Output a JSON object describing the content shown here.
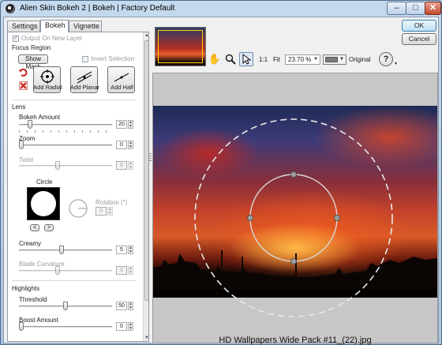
{
  "window": {
    "title": "Alien Skin Bokeh 2 | Bokeh | Factory Default",
    "min_glyph": "–",
    "max_glyph": "□",
    "close_glyph": "✕"
  },
  "tabs": [
    {
      "label": "Settings",
      "active": false
    },
    {
      "label": "Bokeh",
      "active": true
    },
    {
      "label": "Vignette",
      "active": false
    }
  ],
  "panel": {
    "output_new_layer": {
      "label": "Output On New Layer",
      "checked": true,
      "enabled": false
    },
    "focus_region": {
      "title": "Focus Region",
      "show_mask": "Show Mask",
      "invert_selection": {
        "label": "Invert Selection",
        "checked": false
      },
      "add_radial": "Add Radial",
      "add_planar": "Add Planar",
      "add_half": "Add Half"
    },
    "lens": {
      "title": "Lens",
      "bokeh_amount": {
        "label": "Bokeh Amount",
        "value": "20",
        "fraction": 0.2
      },
      "zoom": {
        "label": "Zoom",
        "value": "0",
        "fraction": 0.0
      },
      "twist": {
        "label": "Twist",
        "value": "0",
        "fraction": 0.4
      },
      "circle": {
        "label": "Circle",
        "prev": "<",
        "next": ">"
      },
      "rotation": {
        "label": "Rotation (°)",
        "value": "0"
      },
      "creamy": {
        "label": "Creamy",
        "value": "5",
        "fraction": 0.45
      },
      "blade_curvature": {
        "label": "Blade Curvature",
        "value": "0",
        "fraction": 0.4
      }
    },
    "highlights": {
      "title": "Highlights",
      "threshold": {
        "label": "Threshold",
        "value": "50",
        "fraction": 0.5
      },
      "boost_amount": {
        "label": "Boost Amount",
        "value": "0",
        "fraction": 0.0
      }
    }
  },
  "toolbar": {
    "hand_icon": "hand-tool-icon",
    "zoom_icon": "magnifier-icon",
    "select_icon": "arrow-pointer-icon",
    "one_to_one": "1:1",
    "fit": "Fit",
    "zoom_level": "23.70 %",
    "original": "Original",
    "help_glyph": "?"
  },
  "buttons": {
    "ok": "OK",
    "cancel": "Cancel"
  },
  "preview": {
    "caption": "HD Wallpapers Wide Pack #11_(22).jpg"
  },
  "colors": {
    "accent": "#3c7fb1",
    "background": "#f0f0f0",
    "preview_gray": "#c7c7c7"
  }
}
